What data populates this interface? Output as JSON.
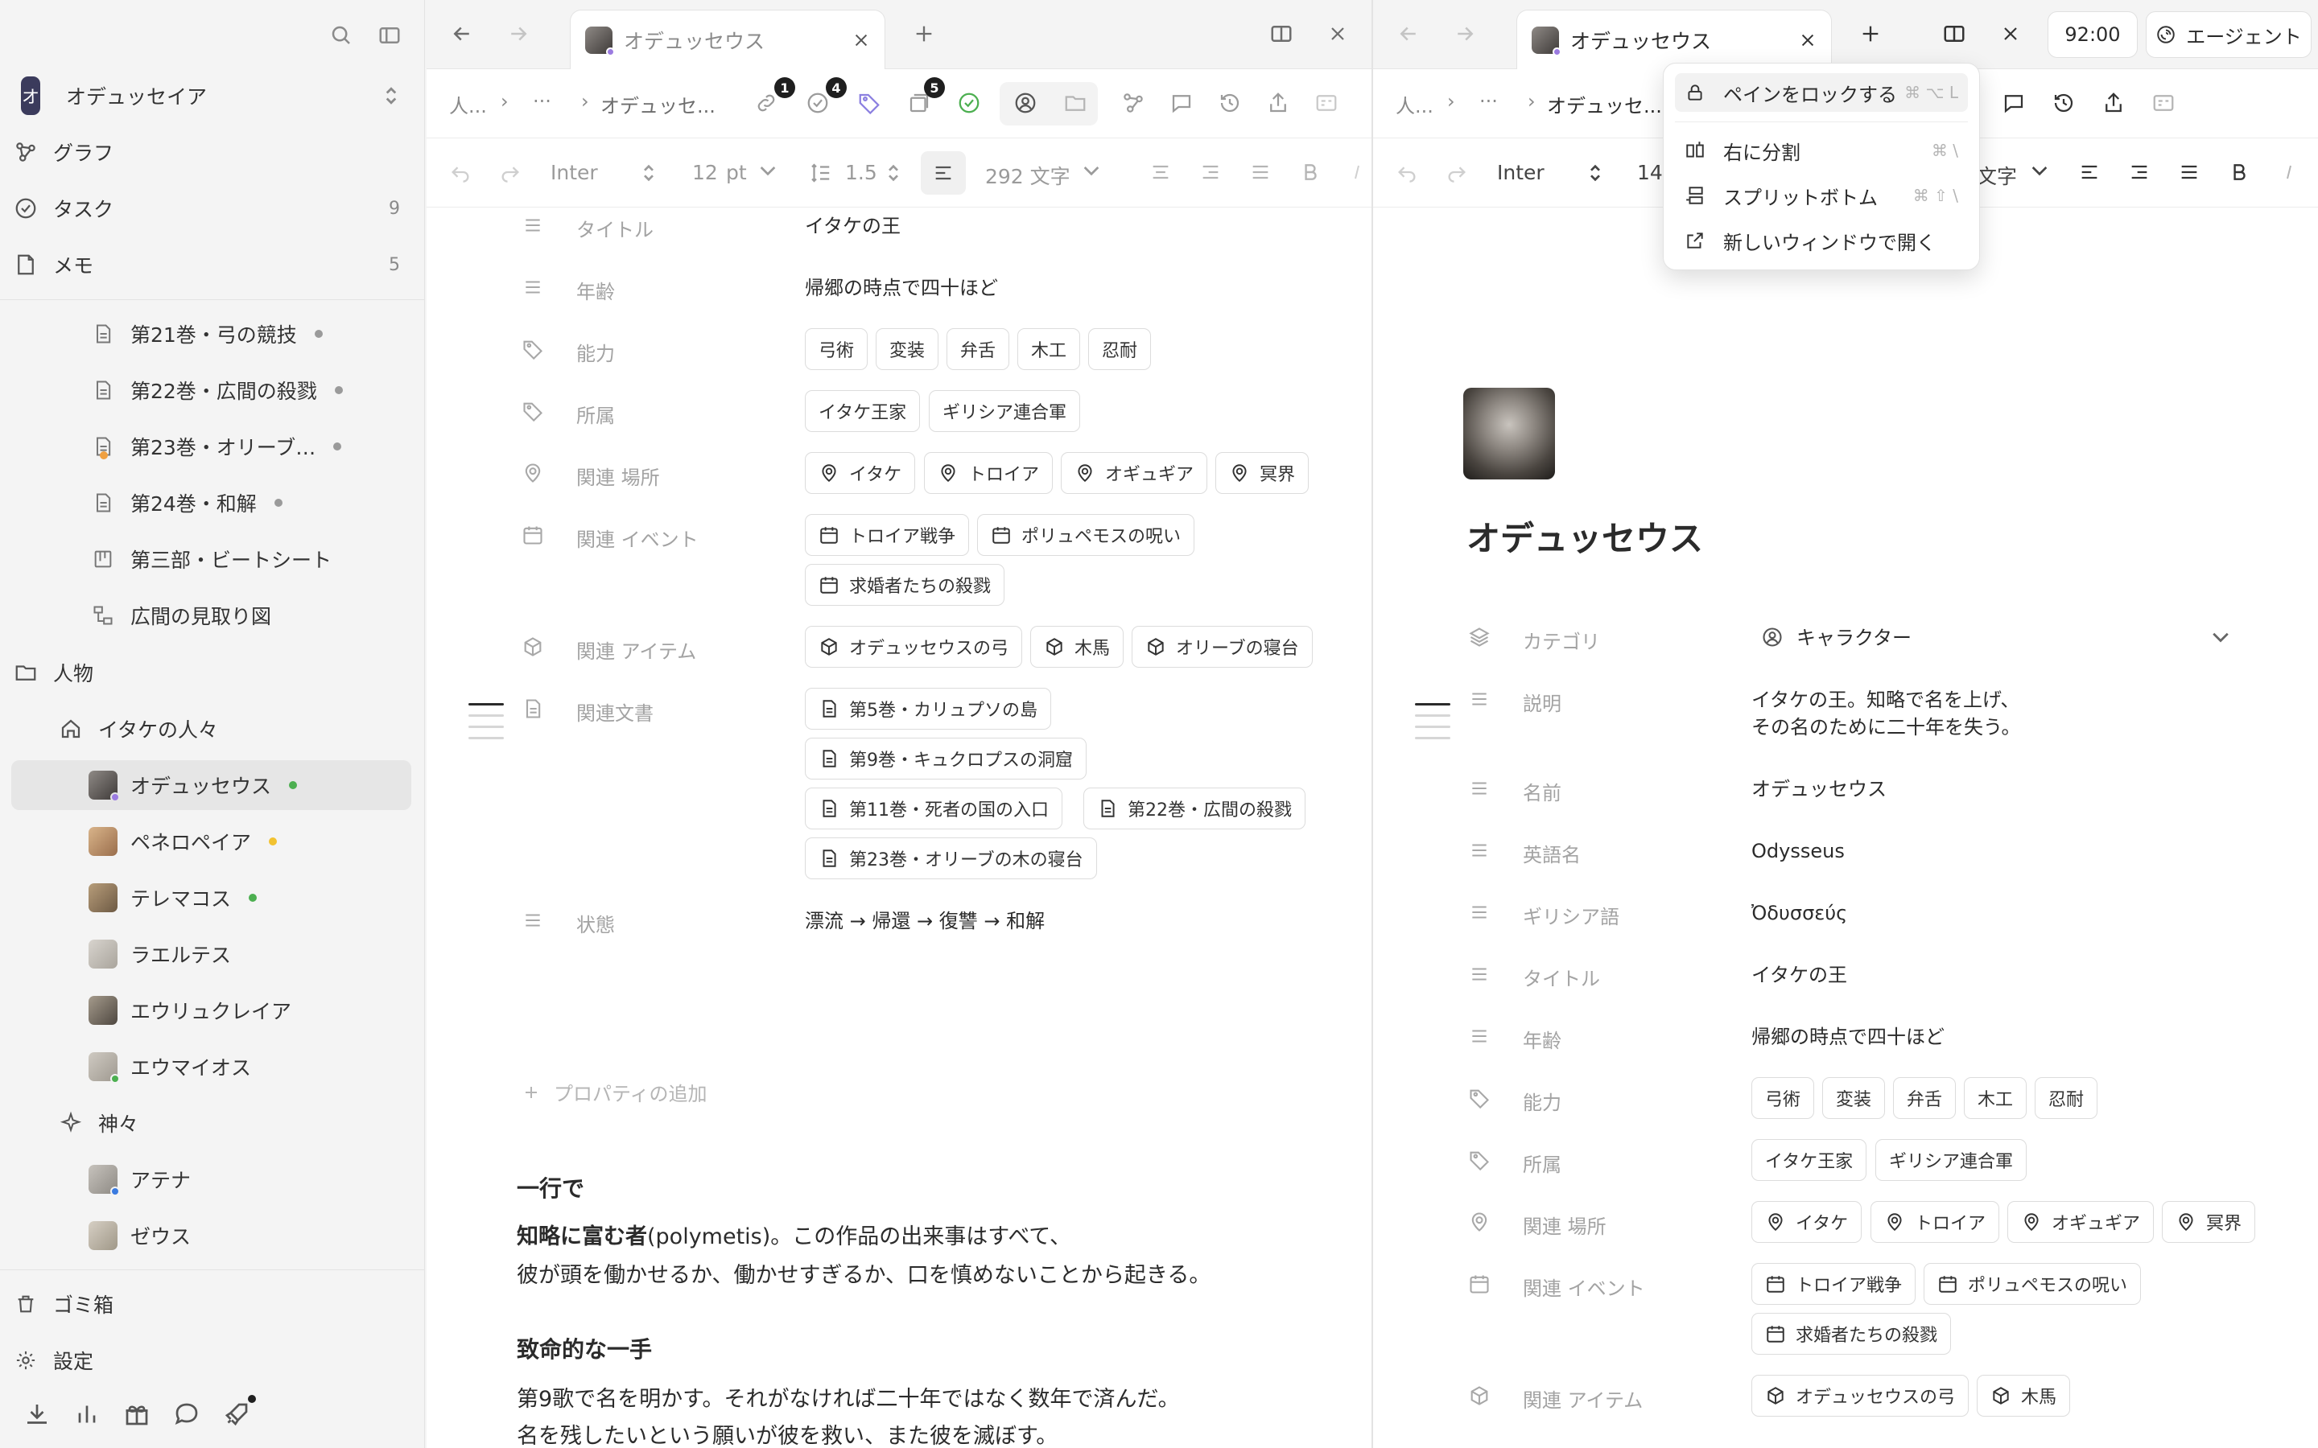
{
  "sidebar": {
    "workspace": {
      "initial": "オ",
      "name": "オデュッセイア"
    },
    "nav": [
      {
        "label": "グラフ",
        "count": ""
      },
      {
        "label": "タスク",
        "count": "9"
      },
      {
        "label": "メモ",
        "count": "5"
      }
    ],
    "docs": [
      {
        "label": "第21巻・弓の競技",
        "dot": "#9a9a9a"
      },
      {
        "label": "第22巻・広間の殺戮",
        "dot": "#9a9a9a"
      },
      {
        "label": "第23巻・オリーブ…",
        "dot": "#9a9a9a"
      },
      {
        "label": "第24巻・和解",
        "dot": "#9a9a9a"
      },
      {
        "label": "第三部・ビートシート",
        "dot": ""
      },
      {
        "label": "広間の見取り図",
        "dot": ""
      }
    ],
    "folder_people": "人物",
    "folder_ithaca": "イタケの人々",
    "people": [
      {
        "label": "オデュッセウス",
        "dot": "#4caf50",
        "active": true
      },
      {
        "label": "ペネロペイア",
        "dot": "#f2c230",
        "active": false
      },
      {
        "label": "テレマコス",
        "dot": "#4caf50",
        "active": false
      },
      {
        "label": "ラエルテス",
        "dot": "",
        "active": false
      },
      {
        "label": "エウリュクレイア",
        "dot": "",
        "active": false
      },
      {
        "label": "エウマイオス",
        "dot": "",
        "active": false
      }
    ],
    "folder_gods": "神々",
    "gods": [
      {
        "label": "アテナ"
      },
      {
        "label": "ゼウス"
      }
    ],
    "trash": "ゴミ箱",
    "settings": "設定"
  },
  "left_pane": {
    "tab_label": "オデュッセウス",
    "breadcrumb": [
      "人...",
      "›",
      "···",
      "›",
      "オデュッセ..."
    ],
    "badges": [
      "1",
      "4",
      "5"
    ],
    "format": {
      "font": "Inter",
      "size": "12",
      "unit": "pt",
      "line_height": "1.5",
      "word_count": "292 文字"
    },
    "props": [
      {
        "label": "タイトル",
        "value": "イタケの王"
      },
      {
        "label": "年齢",
        "value": "帰郷の時点で四十ほど"
      },
      {
        "label": "能力",
        "chips": [
          "弓術",
          "変装",
          "弁舌",
          "木工",
          "忍耐"
        ]
      },
      {
        "label": "所属",
        "chips": [
          "イタケ王家",
          "ギリシア連合軍"
        ]
      },
      {
        "label": "関連 場所",
        "chips": [
          "イタケ",
          "トロイア",
          "オギュギア",
          "冥界"
        ]
      },
      {
        "label": "関連 イベント",
        "chips": [
          "トロイア戦争",
          "ポリュペモスの呪い",
          "求婚者たちの殺戮"
        ]
      },
      {
        "label": "関連 アイテム",
        "chips": [
          "オデュッセウスの弓",
          "木馬",
          "オリーブの寝台"
        ]
      },
      {
        "label": "関連文書",
        "chips": [
          "第5巻・カリュプソの島",
          "第9巻・キュクロプスの洞窟",
          "第11巻・死者の国の入口",
          "第22巻・広間の殺戮",
          "第23巻・オリーブの木の寝台"
        ]
      },
      {
        "label": "状態",
        "value": "漂流 → 帰還 → 復讐 → 和解"
      }
    ],
    "add_property": "プロパティの追加",
    "body": {
      "h1": "一行で",
      "p1_bold": "知略に富む者",
      "p1_rest": "(polymetis)。この作品の出来事はすべて、",
      "p1_line2": "彼が頭を働かせるか、働かせすぎるか、口を慎めないことから起きる。",
      "h2": "致命的な一手",
      "p2_line1": "第9歌で名を明かす。それがなければ二十年ではなく数年で済んだ。",
      "p2_line2": "名を残したいという願いが彼を救い、また彼を滅ぼす。"
    }
  },
  "right_pane": {
    "tab_label": "オデュッセウス",
    "time": "92:00",
    "agent": "エージェント",
    "breadcrumb": [
      "人...",
      "›",
      "···",
      "›",
      "オデュッセ..."
    ],
    "format": {
      "font": "Inter",
      "size": "14",
      "word_count": "文字"
    },
    "title": "オデュッセウス",
    "props": [
      {
        "label": "カテゴリ",
        "value": "キャラクター"
      },
      {
        "label": "説明",
        "value": "イタケの王。知略で名を上げ、",
        "value2": "その名のために二十年を失う。"
      },
      {
        "label": "名前",
        "value": "オデュッセウス"
      },
      {
        "label": "英語名",
        "value": "Odysseus"
      },
      {
        "label": "ギリシア語",
        "value": "Ὀδυσσεύς"
      },
      {
        "label": "タイトル",
        "value": "イタケの王"
      },
      {
        "label": "年齢",
        "value": "帰郷の時点で四十ほど"
      },
      {
        "label": "能力",
        "chips": [
          "弓術",
          "変装",
          "弁舌",
          "木工",
          "忍耐"
        ]
      },
      {
        "label": "所属",
        "chips": [
          "イタケ王家",
          "ギリシア連合軍"
        ]
      },
      {
        "label": "関連 場所",
        "chips": [
          "イタケ",
          "トロイア",
          "オギュギア",
          "冥界"
        ]
      },
      {
        "label": "関連 イベント",
        "chips": [
          "トロイア戦争",
          "ポリュペモスの呪い",
          "求婚者たちの殺戮"
        ]
      },
      {
        "label": "関連 アイテム",
        "chips": [
          "オデュッセウスの弓",
          "木馬"
        ]
      }
    ]
  },
  "context_menu": {
    "items": [
      {
        "label": "ペインをロックする",
        "shortcut": "⌘ ⌥ L"
      },
      {
        "label": "右に分割",
        "shortcut": "⌘ \\"
      },
      {
        "label": "スプリットボトム",
        "shortcut": "⌘ ⇧ \\"
      },
      {
        "label": "新しいウィンドウで開く",
        "shortcut": ""
      }
    ]
  }
}
